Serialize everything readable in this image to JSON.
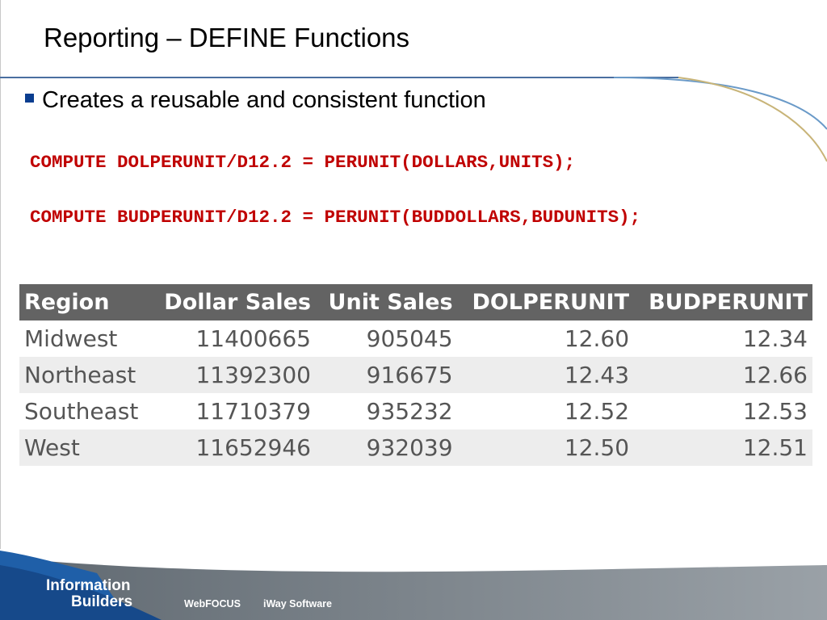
{
  "slide": {
    "title": "Reporting – DEFINE Functions",
    "bullet": "Creates a reusable and consistent function",
    "code_lines": [
      "COMPUTE DOLPERUNIT/D12.2 = PERUNIT(DOLLARS,UNITS);",
      "COMPUTE BUDPERUNIT/D12.2 = PERUNIT(BUDDOLLARS,BUDUNITS);"
    ]
  },
  "table": {
    "headers": [
      "Region",
      "Dollar Sales",
      "Unit Sales",
      "DOLPERUNIT",
      "BUDPERUNIT"
    ],
    "rows": [
      [
        "Midwest",
        "11400665",
        "905045",
        "12.60",
        "12.34"
      ],
      [
        "Northeast",
        "11392300",
        "916675",
        "12.43",
        "12.66"
      ],
      [
        "Southeast",
        "11710379",
        "935232",
        "12.52",
        "12.53"
      ],
      [
        "West",
        "11652946",
        "932039",
        "12.50",
        "12.51"
      ]
    ]
  },
  "footer": {
    "logo_line1": "Information",
    "logo_line2": "Builders",
    "links": [
      "WebFOCUS",
      "iWay Software"
    ]
  },
  "colors": {
    "accent_blue": "#0a3d8f",
    "code_red": "#c00000",
    "table_header": "#636363",
    "footer_gray": "#6e767d"
  }
}
